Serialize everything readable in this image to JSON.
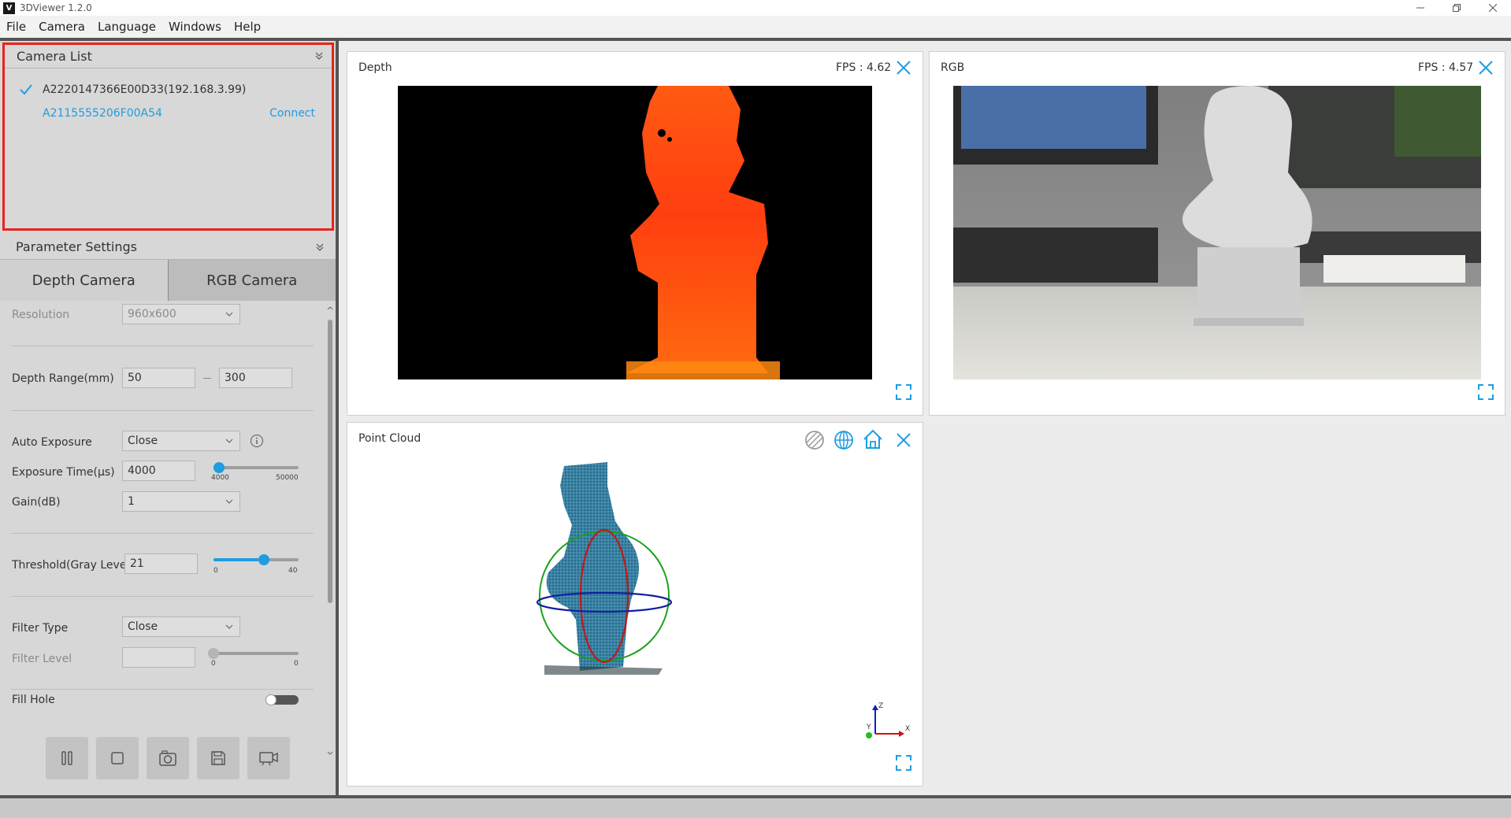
{
  "window": {
    "title": "3DViewer 1.2.0",
    "logo": "V"
  },
  "menu": [
    "File",
    "Camera",
    "Language",
    "Windows",
    "Help"
  ],
  "camera_list": {
    "title": "Camera List",
    "cameras": [
      {
        "name": "A2220147366E00D33(192.168.3.99)",
        "connected": true
      },
      {
        "name": "A2115555206F00A54",
        "action": "Connect"
      }
    ]
  },
  "params": {
    "title": "Parameter Settings",
    "tabs": [
      "Depth Camera",
      "RGB Camera"
    ],
    "resolution": {
      "label": "Resolution",
      "value": "960x600"
    },
    "depth_range": {
      "label": "Depth Range(mm)",
      "min": "50",
      "max": "300"
    },
    "auto_exposure": {
      "label": "Auto Exposure",
      "value": "Close"
    },
    "exposure_time": {
      "label": "Exposure Time(μs)",
      "value": "4000",
      "min": "4000",
      "max": "50000",
      "level": 0.0
    },
    "gain": {
      "label": "Gain(dB)",
      "value": "1"
    },
    "threshold": {
      "label": "Threshold(Gray Level)",
      "value": "21",
      "min": "0",
      "max": "40",
      "level": 0.525
    },
    "filter_type": {
      "label": "Filter Type",
      "value": "Close"
    },
    "filter_level": {
      "label": "Filter Level",
      "value": "",
      "min": "0",
      "max": "0"
    },
    "fill_hole": {
      "label": "Fill Hole",
      "on": false
    }
  },
  "views": {
    "depth": {
      "title": "Depth",
      "fps": "FPS : 4.62"
    },
    "rgb": {
      "title": "RGB",
      "fps": "FPS : 4.57"
    },
    "point_cloud": {
      "title": "Point Cloud",
      "axes": {
        "z": "Z",
        "y": "Y",
        "x": "X"
      }
    }
  },
  "colors": {
    "accent": "#1e9de0",
    "highlight": "#e8231b"
  }
}
